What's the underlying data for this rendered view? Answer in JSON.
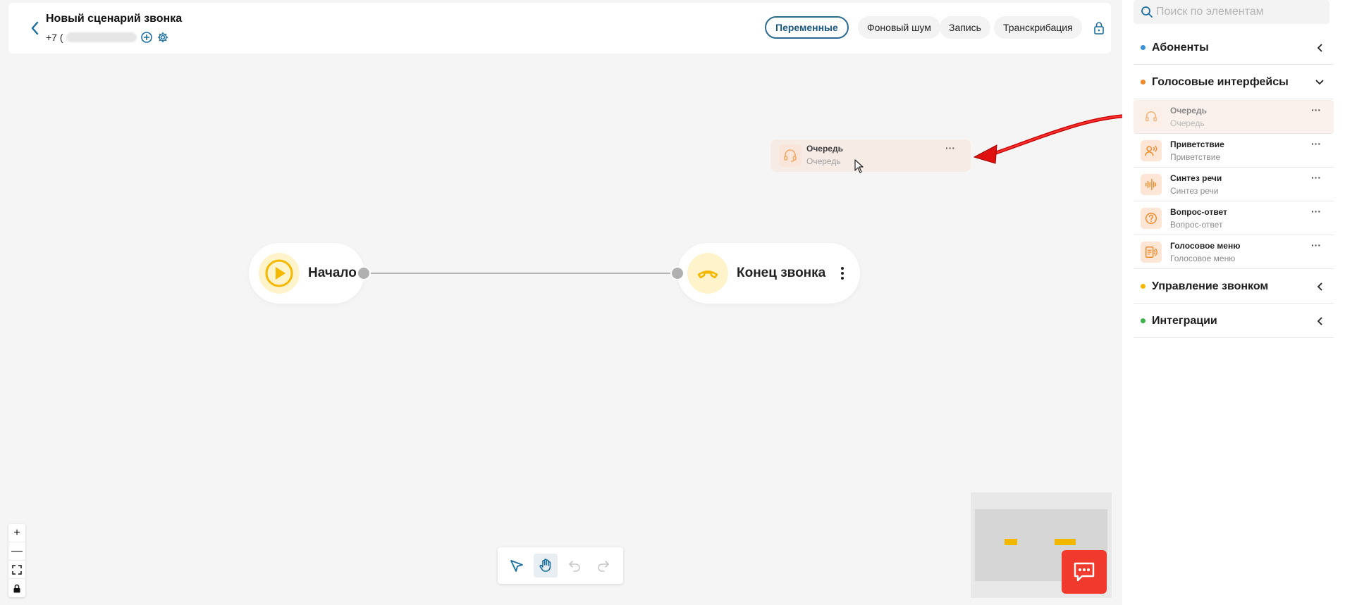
{
  "header": {
    "back_icon": "chevron-left-icon",
    "title": "Новый сценарий звонка",
    "phone_prefix": "+7 (",
    "add_icon": "plus-circle-icon",
    "settings_icon": "gear-icon",
    "tabs": [
      {
        "label": "Переменные",
        "active": true
      },
      {
        "label": "Фоновый шум",
        "active": false
      },
      {
        "label": "Запись",
        "active": false
      },
      {
        "label": "Транскрибация",
        "active": false
      }
    ],
    "lock_icon": "lock-icon",
    "accent_color": "#1a5a85"
  },
  "canvas": {
    "nodes": [
      {
        "label": "Начало",
        "icon": "play-icon"
      },
      {
        "label": "Конец звонка",
        "icon": "hangup-icon"
      }
    ],
    "drag_preview": {
      "title": "Очередь",
      "subtitle": "Очередь",
      "more": "···",
      "icon": "headset-icon"
    },
    "zoom_controls": [
      "+",
      "—",
      "fit-screen-icon",
      "lock-icon"
    ]
  },
  "toolbar": {
    "tools": [
      "select-arrow-icon",
      "hand-pan-icon",
      "undo-icon",
      "redo-icon"
    ],
    "active_tool": "hand-pan-icon"
  },
  "sidebar": {
    "search_placeholder": "Поиск по элементам",
    "categories": [
      {
        "label": "Абоненты",
        "color": "#3b8fd9",
        "expanded": false
      },
      {
        "label": "Голосовые интерфейсы",
        "color": "#f08a2a",
        "expanded": true
      },
      {
        "label": "Управление звонком",
        "color": "#f5b800",
        "expanded": false
      },
      {
        "label": "Интеграции",
        "color": "#3cb44b",
        "expanded": false
      }
    ],
    "voice_items": [
      {
        "title": "Очередь",
        "subtitle": "Очередь",
        "icon": "headset-icon"
      },
      {
        "title": "Приветствие",
        "subtitle": "Приветствие",
        "icon": "speaking-person-icon"
      },
      {
        "title": "Синтез речи",
        "subtitle": "Синтез речи",
        "icon": "audio-wave-icon"
      },
      {
        "title": "Вопрос-ответ",
        "subtitle": "Вопрос-ответ",
        "icon": "question-circle-icon"
      },
      {
        "title": "Голосовое меню",
        "subtitle": "Голосовое меню",
        "icon": "voice-menu-icon"
      }
    ],
    "more_label": "···"
  },
  "chat_button_icon": "chat-bubble-icon"
}
